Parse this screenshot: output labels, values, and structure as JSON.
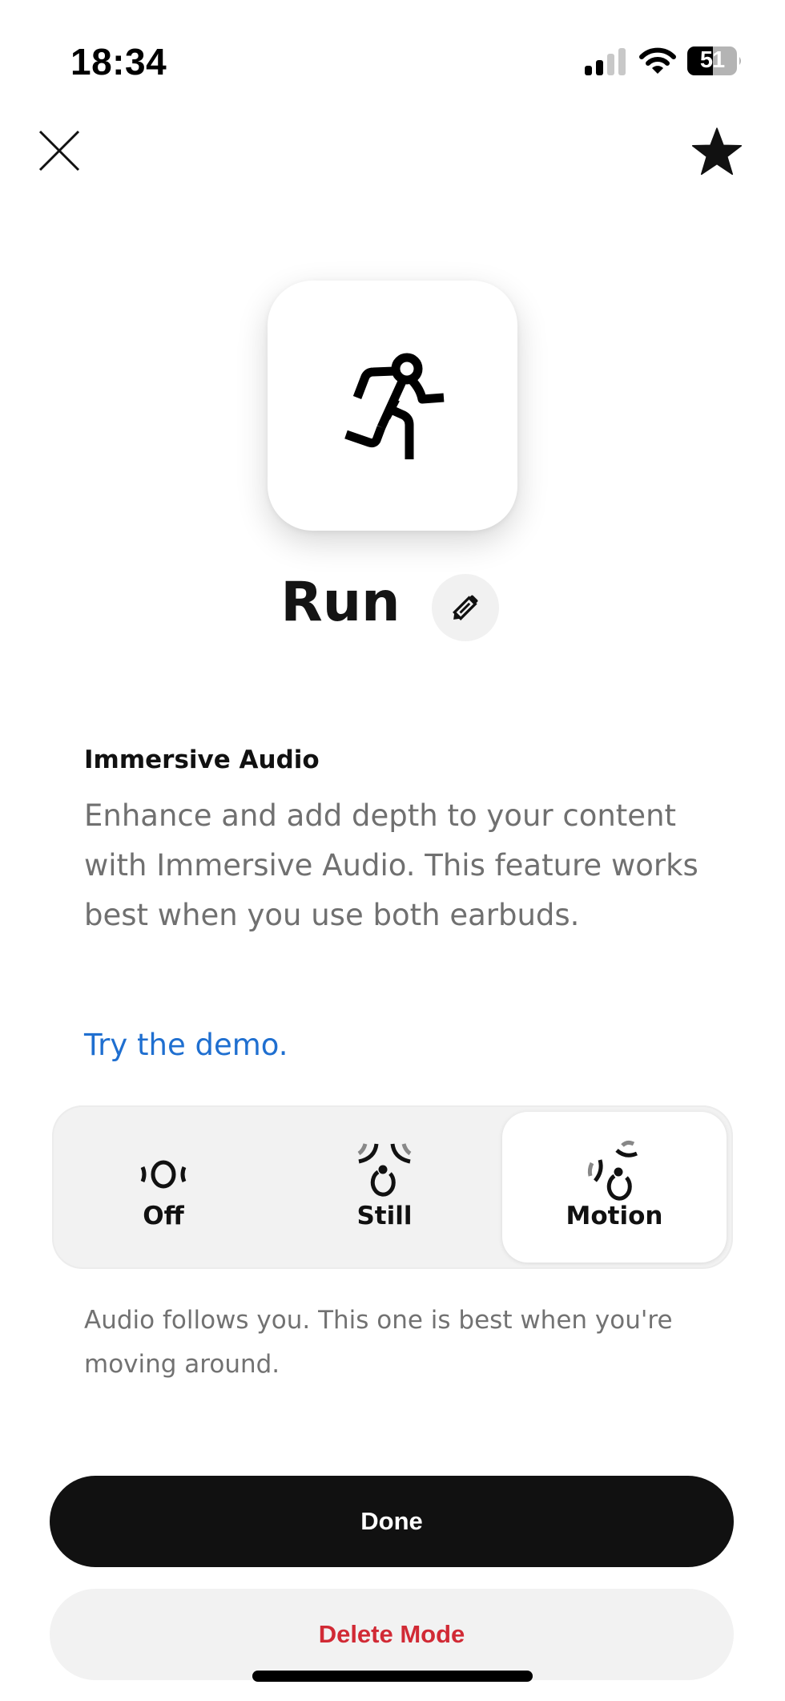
{
  "status_bar": {
    "time": "18:34",
    "battery_level": "51",
    "signal_bars_active": 2,
    "signal_bars_total": 4
  },
  "nav": {
    "close_icon": "close-icon",
    "favorite_icon": "star-icon"
  },
  "mode": {
    "icon": "running-person-icon",
    "title": "Run",
    "edit_icon": "pencil-icon"
  },
  "immersive_audio": {
    "title": "Immersive Audio",
    "description": "Enhance and add depth to your content with Immersive Audio. This feature works best when you use both earbuds.",
    "demo_link": "Try the demo."
  },
  "segmented_control": {
    "options": [
      {
        "label": "Off",
        "icon": "audio-off-icon"
      },
      {
        "label": "Still",
        "icon": "audio-still-icon"
      },
      {
        "label": "Motion",
        "icon": "audio-motion-icon"
      }
    ],
    "selected": "Motion",
    "selected_caption": "Audio follows you. This one is best when you're moving around."
  },
  "actions": {
    "done_label": "Done",
    "delete_label": "Delete Mode"
  },
  "colors": {
    "link": "#1f6fd0",
    "destructive": "#d12a35",
    "primary_button": "#111111",
    "secondary_button": "#f2f2f2"
  }
}
